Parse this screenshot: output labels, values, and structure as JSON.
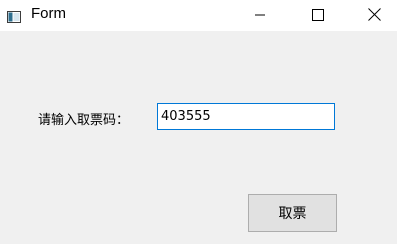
{
  "window": {
    "title": "Form",
    "icon": "form-app-icon"
  },
  "controls": {
    "minimize": "minimize-icon",
    "maximize": "maximize-icon",
    "close": "close-icon"
  },
  "form": {
    "prompt_label": "请输入取票码：",
    "ticket_code_value": "403555",
    "submit_label": "取票"
  },
  "colors": {
    "titlebar": "#ffffff",
    "background": "#f0f0f0",
    "focus_border": "#0078d7",
    "button_bg": "#e1e1e1",
    "button_border": "#adadad"
  }
}
